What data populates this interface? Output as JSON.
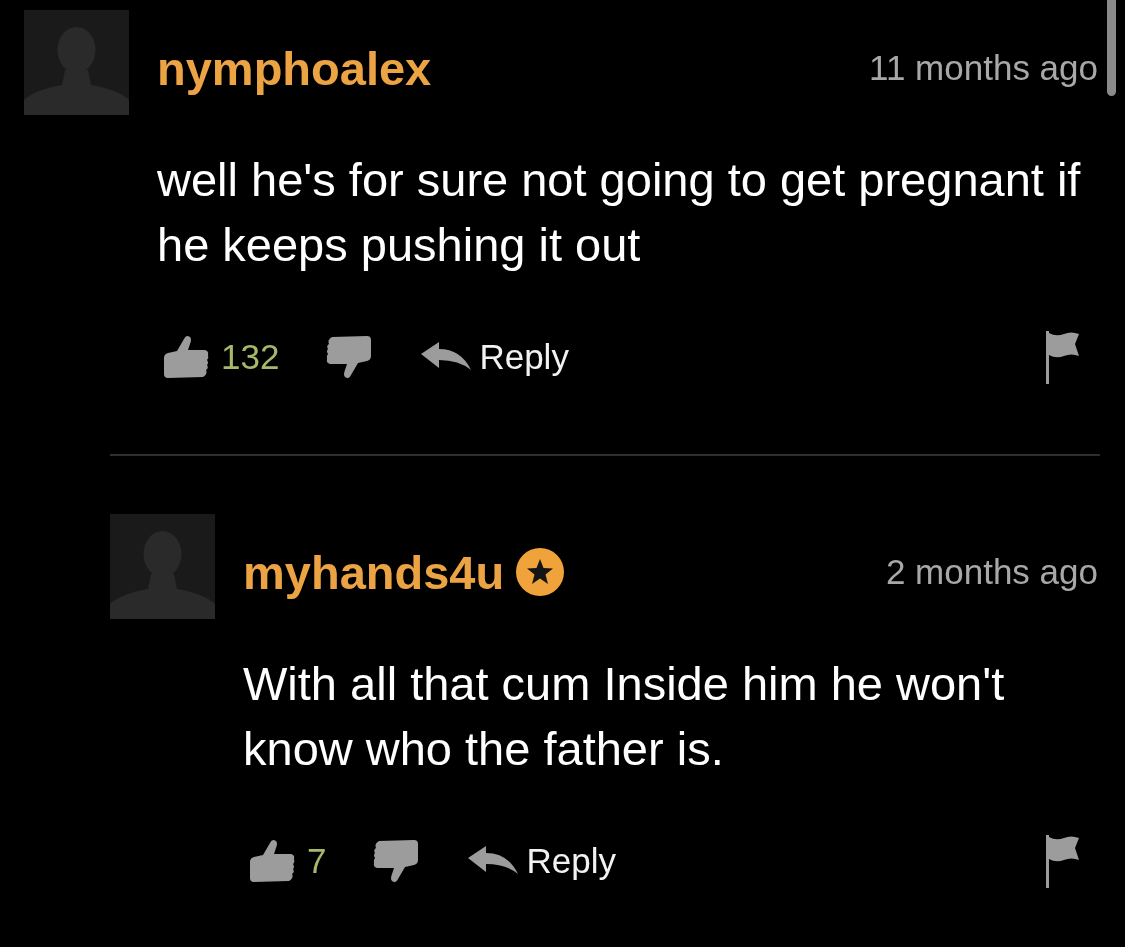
{
  "comments": [
    {
      "username": "nymphoalex",
      "badge": false,
      "time": "11 months ago",
      "text": "well he's for sure not going to get pregnant if he keeps pushing it out",
      "likes": "132",
      "reply_label": "Reply",
      "children": [
        {
          "username": "myhands4u",
          "badge": true,
          "time": "2 months ago",
          "text": "With all that cum Inside him he won't know who the father is.",
          "likes": "7",
          "reply_label": "Reply"
        }
      ]
    }
  ]
}
